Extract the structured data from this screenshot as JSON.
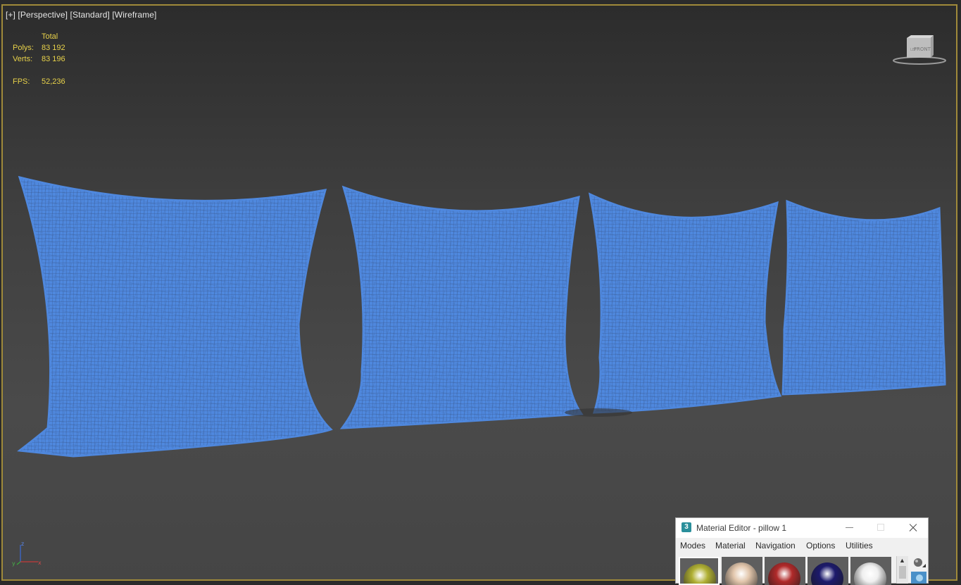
{
  "viewport": {
    "label_plus": "[+]",
    "label_view": "[Perspective]",
    "label_shading": "[Standard]",
    "label_mode": "[Wireframe]",
    "stats": {
      "header": "Total",
      "polys_label": "Polys:",
      "polys_value": "83 192",
      "verts_label": "Verts:",
      "verts_value": "83 196",
      "fps_label": "FPS:",
      "fps_value": "52,236"
    },
    "viewcube_face": "FRONT",
    "viewcube_side": "LEFT"
  },
  "axis_gizmo": {
    "z": "z",
    "x": "x",
    "y": "y"
  },
  "wireframe_color": "#4f88de",
  "material_editor": {
    "title": "Material Editor - pillow 1",
    "logo": "3",
    "menus": [
      "Modes",
      "Material",
      "Navigation",
      "Options",
      "Utilities"
    ],
    "swatches": [
      {
        "color": "#b0b034",
        "icon": "material-sphere-yellow"
      },
      {
        "color": "#e2c6ac",
        "icon": "material-sphere-beige"
      },
      {
        "color": "#b02a2a",
        "icon": "material-sphere-red"
      },
      {
        "color": "#1c1a6c",
        "icon": "material-sphere-navy"
      },
      {
        "color": "#f0f0f0",
        "icon": "material-sphere-white"
      }
    ]
  }
}
